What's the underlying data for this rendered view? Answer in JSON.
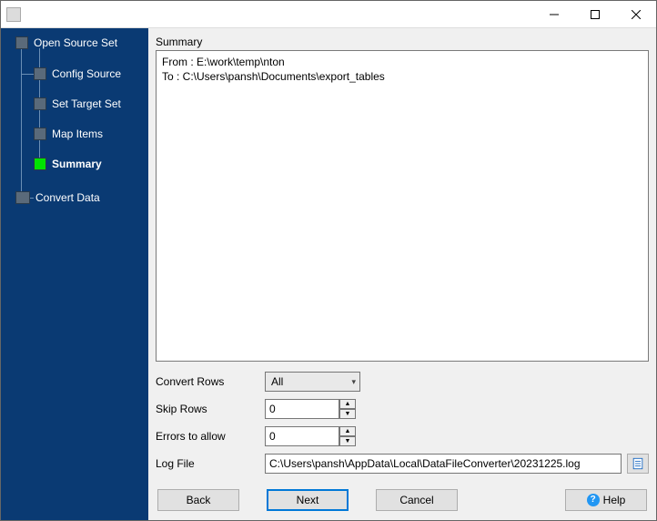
{
  "titlebar": {
    "title": ""
  },
  "sidebar": {
    "items": [
      {
        "label": "Open Source Set"
      },
      {
        "label": "Config Source"
      },
      {
        "label": "Set Target Set"
      },
      {
        "label": "Map Items"
      },
      {
        "label": "Summary",
        "current": true
      },
      {
        "label": "Convert Data"
      }
    ]
  },
  "main": {
    "section_label": "Summary",
    "summary_text": "From : E:\\work\\temp\\nton\nTo : C:\\Users\\pansh\\Documents\\export_tables",
    "form": {
      "convert_rows_label": "Convert Rows",
      "convert_rows_value": "All",
      "skip_rows_label": "Skip Rows",
      "skip_rows_value": "0",
      "errors_label": "Errors to allow",
      "errors_value": "0",
      "logfile_label": "Log File",
      "logfile_value": "C:\\Users\\pansh\\AppData\\Local\\DataFileConverter\\20231225.log"
    }
  },
  "footer": {
    "back": "Back",
    "next": "Next",
    "cancel": "Cancel",
    "help": "Help"
  }
}
